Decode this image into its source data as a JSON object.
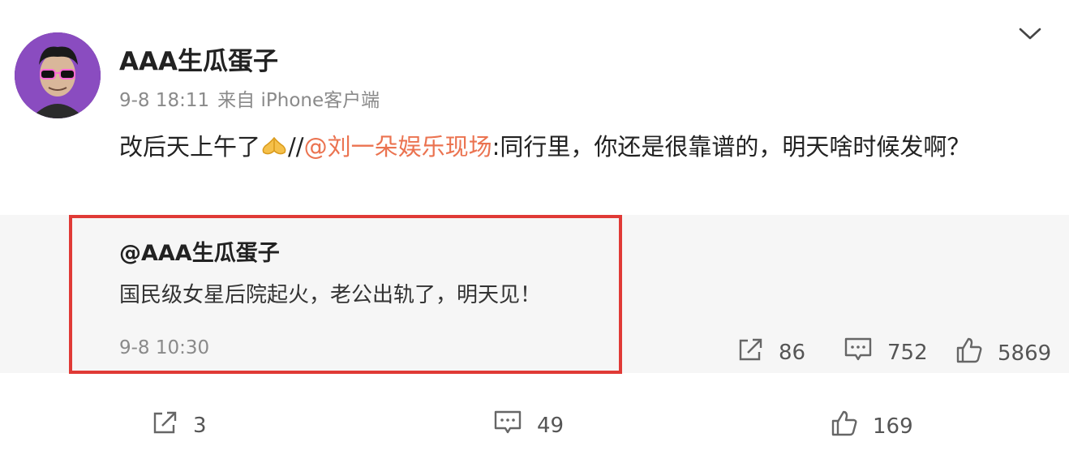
{
  "post": {
    "username": "AAA生瓜蛋子",
    "time": "9-8 18:11",
    "source": "来自 iPhone客户端",
    "text_before": "改后天上午了",
    "text_separator": "//",
    "mention": "@刘一朵娱乐现场",
    "text_after": ":同行里，你还是很靠谱的，明天啥时候发啊？",
    "icons": {
      "menu": "chevron-down-icon",
      "emoji": "pray-emoji-icon"
    }
  },
  "retweet": {
    "user": "@AAA生瓜蛋子",
    "text": "国民级女星后院起火，老公出轨了，明天见！",
    "time": "9-8 10:30",
    "stats": {
      "share": "86",
      "comment": "752",
      "like": "5869"
    },
    "highlight_color": "#e03a36"
  },
  "actions": {
    "share": "3",
    "comment": "49",
    "like": "169"
  },
  "colors": {
    "mention": "#eb7350",
    "retweet_bg": "#f6f6f6",
    "meta_text": "#8a8a8a"
  }
}
